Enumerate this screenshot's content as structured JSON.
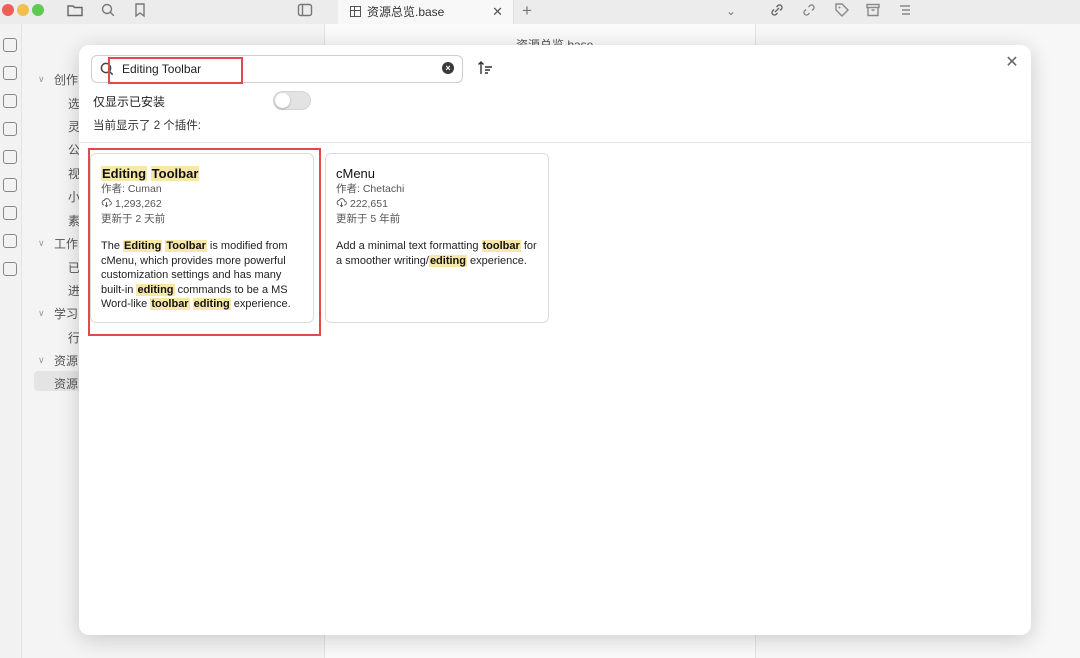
{
  "titlebar": {
    "tab_title": "资源总览.base",
    "tab_close": "✕",
    "tab_add": "+",
    "tab_menu": "⌄"
  },
  "sidebar": {
    "groups": [
      {
        "label": "创作",
        "items": [
          "选",
          "灵",
          "公",
          "视",
          "小",
          "素"
        ]
      },
      {
        "label": "工作",
        "items": [
          "已",
          "进"
        ]
      },
      {
        "label": "学习",
        "items": [
          "行"
        ]
      },
      {
        "label": "资源",
        "items": [
          "资源"
        ]
      }
    ]
  },
  "editor": {
    "title": "资源总览.base"
  },
  "modal": {
    "close": "✕",
    "search": {
      "value": "Editing Toolbar",
      "placeholder": ""
    },
    "installed_only_label": "仅显示已安装",
    "installed_only_on": false,
    "count_label": "当前显示了 2 个插件:",
    "plugins": [
      {
        "name_parts": [
          "Editing",
          " ",
          "Toolbar"
        ],
        "author": "作者: Cuman",
        "downloads": "1,293,262",
        "updated": "更新于 2 天前"
      },
      {
        "name": "cMenu",
        "author": "作者: Chetachi",
        "downloads": "222,651",
        "updated": "更新于 5 年前"
      }
    ]
  },
  "colors": {
    "highlight_box": "#e04a4a",
    "match_highlight": "#f7e7a8"
  },
  "icons": [
    "search-icon",
    "clear-icon",
    "sort-icon",
    "download-icon",
    "close-icon"
  ]
}
